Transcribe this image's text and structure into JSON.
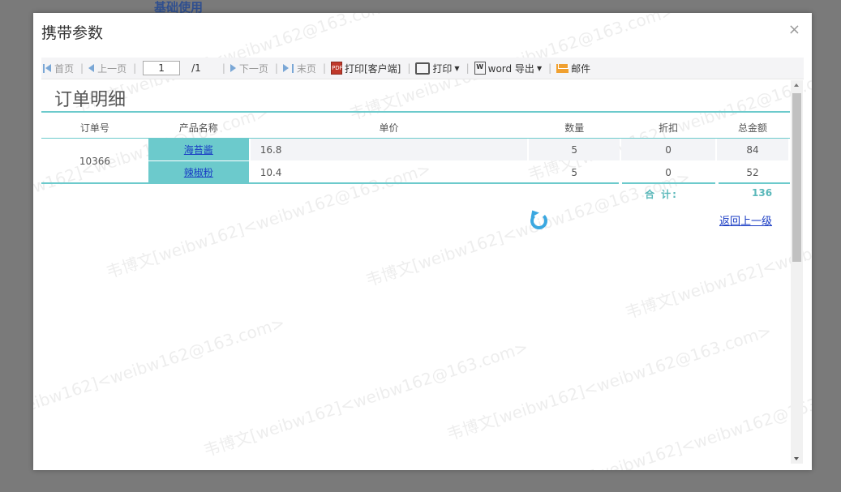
{
  "background": {
    "page_title": "基础使用"
  },
  "modal": {
    "title": "携带参数",
    "close_glyph": "×"
  },
  "toolbar": {
    "first": "首页",
    "prev": "上一页",
    "page_value": "1",
    "page_total": "/1",
    "next": "下一页",
    "last": "末页",
    "print_client": "打印[客户端]",
    "print": "打印",
    "word_export": "word 导出",
    "mail": "邮件",
    "icons": {
      "first": "first-page-icon",
      "prev": "prev-page-icon",
      "next": "next-page-icon",
      "last": "last-page-icon",
      "pdf": "pdf-print-icon",
      "print": "printer-icon",
      "word": "word-icon",
      "mail": "mail-icon"
    }
  },
  "report": {
    "title": "订单明细",
    "columns": [
      "订单号",
      "产品名称",
      "单价",
      "数量",
      "折扣",
      "总金额"
    ],
    "order_id": "10366",
    "rows": [
      {
        "product": "海苔酱",
        "price": "16.8",
        "qty": "5",
        "discount": "0",
        "amount": "84"
      },
      {
        "product": "辣椒粉",
        "price": "10.4",
        "qty": "5",
        "discount": "0",
        "amount": "52"
      }
    ],
    "total_label": "合  计:",
    "total_value": "136",
    "back_link": "返回上一级"
  },
  "watermark": "韦博文[weibw162]<weibw162@163.com>",
  "colors": {
    "accent": "#6ccacc",
    "link": "#1a3cc4",
    "total": "#5ab8ba",
    "refresh": "#3aa7e0"
  }
}
